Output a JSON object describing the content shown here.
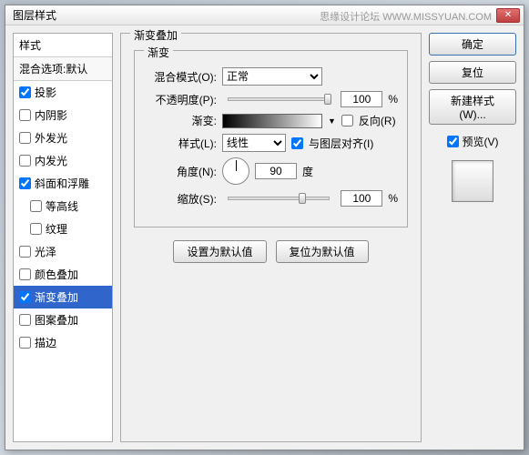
{
  "title": "图层样式",
  "watermark": "思缘设计论坛  WWW.MISSYUAN.COM",
  "left": {
    "header": "样式",
    "subheader": "混合选项:默认",
    "items": [
      {
        "label": "投影",
        "checked": true,
        "indent": false
      },
      {
        "label": "内阴影",
        "checked": false,
        "indent": false
      },
      {
        "label": "外发光",
        "checked": false,
        "indent": false
      },
      {
        "label": "内发光",
        "checked": false,
        "indent": false
      },
      {
        "label": "斜面和浮雕",
        "checked": true,
        "indent": false
      },
      {
        "label": "等高线",
        "checked": false,
        "indent": true
      },
      {
        "label": "纹理",
        "checked": false,
        "indent": true
      },
      {
        "label": "光泽",
        "checked": false,
        "indent": false
      },
      {
        "label": "颜色叠加",
        "checked": false,
        "indent": false
      },
      {
        "label": "渐变叠加",
        "checked": true,
        "indent": false,
        "selected": true
      },
      {
        "label": "图案叠加",
        "checked": false,
        "indent": false
      },
      {
        "label": "描边",
        "checked": false,
        "indent": false
      }
    ]
  },
  "center": {
    "title": "渐变叠加",
    "group": "渐变",
    "blend_mode_label": "混合模式(O):",
    "blend_mode_value": "正常",
    "opacity_label": "不透明度(P):",
    "opacity_value": "100",
    "percent": "%",
    "gradient_label": "渐变:",
    "reverse_label": "反向(R)",
    "style_label": "样式(L):",
    "style_value": "线性",
    "align_label": "与图层对齐(I)",
    "angle_label": "角度(N):",
    "angle_value": "90",
    "degree": "度",
    "scale_label": "缩放(S):",
    "scale_value": "100",
    "set_default": "设置为默认值",
    "reset_default": "复位为默认值"
  },
  "right": {
    "ok": "确定",
    "cancel": "复位",
    "new_style": "新建样式(W)...",
    "preview_label": "预览(V)"
  }
}
